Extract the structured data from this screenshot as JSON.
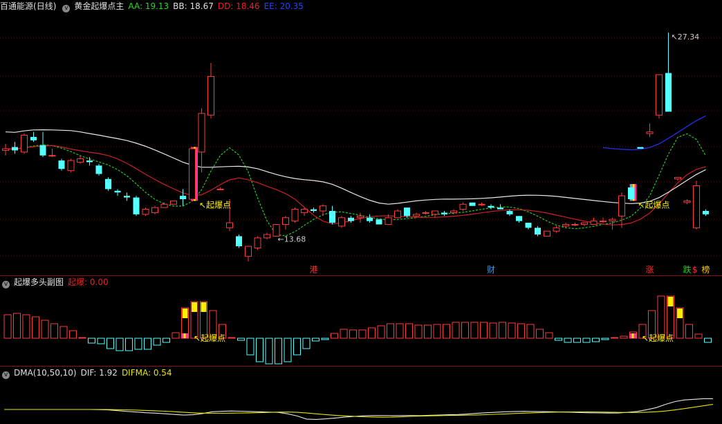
{
  "main_panel": {
    "stock_name": "百通能源",
    "period": "(日线)",
    "indicator_name": "黄金起爆点主",
    "indicators": [
      {
        "label": "AA:",
        "value": "19.13",
        "color": "#22dd22"
      },
      {
        "label": "BB:",
        "value": "18.67",
        "color": "#e0e0e0"
      },
      {
        "label": "DD:",
        "value": "18.46",
        "color": "#ee2222"
      },
      {
        "label": "EE:",
        "value": "20.35",
        "color": "#2244ff"
      }
    ],
    "signal_labels": [
      "起爆点",
      "起爆点"
    ],
    "high_label": "27.34",
    "low_label": "13.68",
    "markers": [
      {
        "text": "港",
        "color": "#ff3333"
      },
      {
        "text": "财",
        "color": "#3399ff"
      },
      {
        "text": "涨",
        "color": "#ff3333"
      },
      {
        "text": "跌",
        "color": "#22cc22"
      },
      {
        "text": "$",
        "color": "#ff3333"
      },
      {
        "text": "榜",
        "color": "#ffcc00"
      }
    ]
  },
  "sub_panel": {
    "name": "起爆多头副图",
    "indicators": [
      {
        "label": "起爆:",
        "value": "0.00",
        "color": "#ee2222"
      }
    ],
    "signal_labels": [
      "起爆点",
      "起爆点"
    ],
    "bars": [
      34,
      36,
      34,
      31,
      26,
      21,
      17,
      11,
      0,
      -7,
      -8,
      -15,
      -18,
      -18,
      -16,
      -16,
      -10,
      -6,
      8,
      44,
      53,
      53,
      40,
      20,
      0,
      -3,
      -24,
      -34,
      -37,
      -37,
      -34,
      -24,
      -15,
      -4,
      -2,
      7,
      13,
      12,
      12,
      15,
      18,
      21,
      21,
      21,
      19,
      19,
      20,
      20,
      23,
      23,
      23,
      23,
      22,
      23,
      22,
      21,
      20,
      13,
      8,
      -3,
      -6,
      -6,
      -6,
      -5,
      -2,
      0,
      3,
      9,
      20,
      40,
      61,
      61,
      44,
      20,
      6,
      -6
    ],
    "signal_bar_indices": [
      19,
      20,
      21,
      71,
      72
    ]
  },
  "dma_panel": {
    "name": "DMA(10,50,10)",
    "indicators": [
      {
        "label": "DIF:",
        "value": "1.92",
        "color": "#e0e0e0"
      },
      {
        "label": "DIFMA:",
        "value": "0.54",
        "color": "#e6e600"
      }
    ]
  },
  "chart_data": [
    {
      "type": "candlestick",
      "title": "黄金起爆点主",
      "ylim": [
        13.0,
        28.5
      ],
      "candles": [
        {
          "o": 20.3,
          "h": 20.7,
          "l": 20.0,
          "c": 20.4
        },
        {
          "o": 20.5,
          "h": 20.8,
          "l": 20.1,
          "c": 20.3
        },
        {
          "o": 20.2,
          "h": 21.3,
          "l": 20.1,
          "c": 21.2
        },
        {
          "o": 21.1,
          "h": 21.4,
          "l": 20.8,
          "c": 20.9
        },
        {
          "o": 20.6,
          "h": 21.4,
          "l": 19.9,
          "c": 20.0
        },
        {
          "o": 20.0,
          "h": 20.4,
          "l": 19.9,
          "c": 20.0
        },
        {
          "o": 19.7,
          "h": 19.8,
          "l": 19.1,
          "c": 19.2
        },
        {
          "o": 19.1,
          "h": 19.8,
          "l": 19.0,
          "c": 19.7
        },
        {
          "o": 19.6,
          "h": 20.0,
          "l": 19.5,
          "c": 19.8
        },
        {
          "o": 19.7,
          "h": 19.9,
          "l": 19.4,
          "c": 19.6
        },
        {
          "o": 19.4,
          "h": 19.5,
          "l": 18.8,
          "c": 18.9
        },
        {
          "o": 18.6,
          "h": 18.7,
          "l": 17.9,
          "c": 18.0
        },
        {
          "o": 17.9,
          "h": 18.0,
          "l": 17.6,
          "c": 17.8
        },
        {
          "o": 17.6,
          "h": 17.8,
          "l": 17.3,
          "c": 17.5
        },
        {
          "o": 17.5,
          "h": 17.6,
          "l": 16.4,
          "c": 16.5
        },
        {
          "o": 16.5,
          "h": 16.9,
          "l": 16.4,
          "c": 16.8
        },
        {
          "o": 16.6,
          "h": 17.0,
          "l": 16.5,
          "c": 16.9
        },
        {
          "o": 16.9,
          "h": 17.2,
          "l": 16.9,
          "c": 17.1
        },
        {
          "o": 17.1,
          "h": 17.3,
          "l": 17.1,
          "c": 17.3
        },
        {
          "o": 17.6,
          "h": 18.0,
          "l": 17.0,
          "c": 17.4
        },
        {
          "o": 17.4,
          "h": 20.5,
          "l": 17.3,
          "c": 20.4
        },
        {
          "o": 20.2,
          "h": 22.8,
          "l": 19.0,
          "c": 22.5
        },
        {
          "o": 22.4,
          "h": 25.5,
          "l": 22.2,
          "c": 24.7
        },
        {
          "o": 18.0,
          "h": 18.1,
          "l": 18.0,
          "c": 18.0
        },
        {
          "o": 15.7,
          "h": 17.4,
          "l": 15.5,
          "c": 16.0
        },
        {
          "o": 15.2,
          "h": 15.3,
          "l": 14.5,
          "c": 14.6
        },
        {
          "o": 14.0,
          "h": 14.6,
          "l": 13.7,
          "c": 14.6
        },
        {
          "o": 14.5,
          "h": 15.2,
          "l": 14.4,
          "c": 15.1
        },
        {
          "o": 15.1,
          "h": 15.4,
          "l": 15.0,
          "c": 15.3
        },
        {
          "o": 15.2,
          "h": 15.9,
          "l": 15.2,
          "c": 15.9
        },
        {
          "o": 15.9,
          "h": 16.4,
          "l": 15.6,
          "c": 16.3
        },
        {
          "o": 16.1,
          "h": 16.9,
          "l": 16.0,
          "c": 16.8
        },
        {
          "o": 16.6,
          "h": 16.9,
          "l": 16.4,
          "c": 16.8
        },
        {
          "o": 16.8,
          "h": 16.9,
          "l": 16.6,
          "c": 16.7
        },
        {
          "o": 16.7,
          "h": 17.1,
          "l": 16.4,
          "c": 17.0
        },
        {
          "o": 16.7,
          "h": 17.0,
          "l": 15.9,
          "c": 16.0
        },
        {
          "o": 15.8,
          "h": 16.4,
          "l": 15.7,
          "c": 16.3
        },
        {
          "o": 16.3,
          "h": 16.4,
          "l": 16.0,
          "c": 16.1
        },
        {
          "o": 16.3,
          "h": 16.6,
          "l": 16.0,
          "c": 16.4
        },
        {
          "o": 16.3,
          "h": 16.5,
          "l": 16.0,
          "c": 16.1
        },
        {
          "o": 16.2,
          "h": 16.2,
          "l": 15.9,
          "c": 15.9
        },
        {
          "o": 15.9,
          "h": 16.5,
          "l": 15.9,
          "c": 16.3
        },
        {
          "o": 16.3,
          "h": 16.8,
          "l": 16.3,
          "c": 16.7
        },
        {
          "o": 16.9,
          "h": 16.9,
          "l": 16.3,
          "c": 16.4
        },
        {
          "o": 16.4,
          "h": 16.6,
          "l": 16.3,
          "c": 16.5
        },
        {
          "o": 16.6,
          "h": 16.7,
          "l": 16.5,
          "c": 16.6
        },
        {
          "o": 16.5,
          "h": 16.7,
          "l": 16.3,
          "c": 16.7
        },
        {
          "o": 16.6,
          "h": 16.7,
          "l": 16.4,
          "c": 16.5
        },
        {
          "o": 16.6,
          "h": 16.8,
          "l": 16.5,
          "c": 16.7
        },
        {
          "o": 16.8,
          "h": 17.2,
          "l": 16.7,
          "c": 17.1
        },
        {
          "o": 17.2,
          "h": 17.2,
          "l": 17.0,
          "c": 17.0
        },
        {
          "o": 17.1,
          "h": 17.2,
          "l": 17.0,
          "c": 17.1
        },
        {
          "o": 17.0,
          "h": 17.1,
          "l": 16.8,
          "c": 16.9
        },
        {
          "o": 16.9,
          "h": 17.1,
          "l": 16.8,
          "c": 16.8
        },
        {
          "o": 16.7,
          "h": 16.8,
          "l": 16.4,
          "c": 16.5
        },
        {
          "o": 16.4,
          "h": 16.4,
          "l": 16.0,
          "c": 16.1
        },
        {
          "o": 16.0,
          "h": 16.0,
          "l": 15.6,
          "c": 15.7
        },
        {
          "o": 15.7,
          "h": 15.8,
          "l": 15.2,
          "c": 15.3
        },
        {
          "o": 15.2,
          "h": 15.5,
          "l": 15.2,
          "c": 15.5
        },
        {
          "o": 15.5,
          "h": 15.8,
          "l": 15.4,
          "c": 15.7
        },
        {
          "o": 15.8,
          "h": 16.0,
          "l": 15.7,
          "c": 15.9
        },
        {
          "o": 15.9,
          "h": 16.0,
          "l": 15.8,
          "c": 15.9
        },
        {
          "o": 15.9,
          "h": 16.0,
          "l": 15.8,
          "c": 16.0
        },
        {
          "o": 15.9,
          "h": 16.3,
          "l": 15.9,
          "c": 16.1
        },
        {
          "o": 16.1,
          "h": 16.3,
          "l": 16.0,
          "c": 16.1
        },
        {
          "o": 16.1,
          "h": 16.3,
          "l": 15.6,
          "c": 16.2
        },
        {
          "o": 16.4,
          "h": 17.8,
          "l": 15.7,
          "c": 17.6
        },
        {
          "o": 18.1,
          "h": 18.3,
          "l": 17.3,
          "c": 17.4
        },
        {
          "o": 20.5,
          "h": 20.5,
          "l": 20.4,
          "c": 20.4
        },
        {
          "o": 21.3,
          "h": 21.9,
          "l": 21.1,
          "c": 21.4
        },
        {
          "o": 22.4,
          "h": 24.5,
          "l": 22.2,
          "c": 24.8
        },
        {
          "o": 24.9,
          "h": 27.3,
          "l": 22.8,
          "c": 22.6
        },
        {
          "o": 18.6,
          "h": 18.7,
          "l": 18.5,
          "c": 18.7
        },
        {
          "o": 17.2,
          "h": 17.4,
          "l": 17.1,
          "c": 17.3
        },
        {
          "o": 15.7,
          "h": 18.5,
          "l": 15.6,
          "c": 18.2
        },
        {
          "o": 16.7,
          "h": 16.8,
          "l": 16.4,
          "c": 16.5
        }
      ]
    },
    {
      "type": "bar",
      "title": "起爆多头副图"
    },
    {
      "type": "line",
      "title": "DMA(10,50,10)"
    }
  ]
}
